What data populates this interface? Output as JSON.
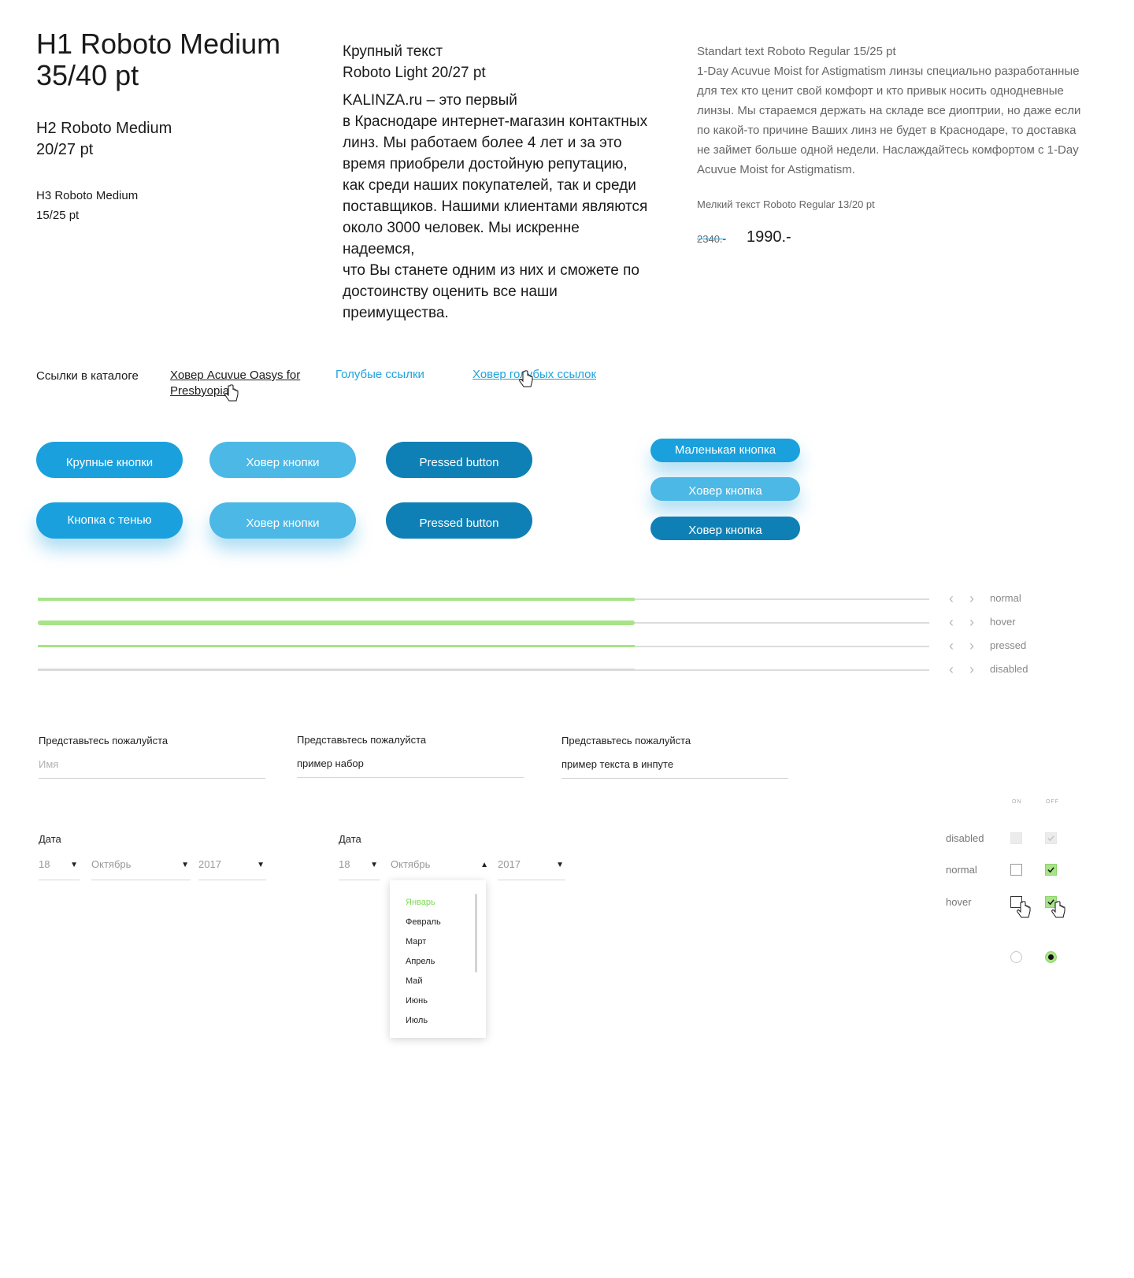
{
  "typography": {
    "h1": "H1 Roboto Medium\n35/40 pt",
    "h1_line1": "H1 Roboto Medium",
    "h1_line2": "35/40 pt",
    "h2_line1": "H2 Roboto Medium",
    "h2_line2": "20/27 pt",
    "h3_line1": "H3 Roboto Medium",
    "h3_line2": "15/25 pt",
    "large_title_line1": "Крупный текст",
    "large_title_line2": "Roboto Light 20/27 pt",
    "large_body": "KALINZA.ru – это первый\nв Краснодаре интернет-магазин контактных линз. Мы работаем более 4 лет и за это время приобрели достойную репутацию, как среди наших покупателей, так и среди поставщиков. Нашими клиентами являются около 3000 человек. Мы искренне надеемся,\nчто Вы станете одним из них и сможете по достоинству оценить все наши преимущества.",
    "standard_title": "Standart text Roboto Regular 15/25 pt",
    "standard_body": "1-Day Acuvue Moist for Astigmatism линзы специально разработанные для тех кто ценит свой комфорт и кто привык носить однодневные линзы. Мы стараемся держать на складе все диоптрии, но даже если по какой-то причине Ваших линз не будет в Краснодаре, то доставка не займет больше одной недели. Наслаждайтесь комфортом с 1-Day Acuvue Moist for Astigmatism.",
    "small_title": "Мелкий текст Roboto Regular 13/20 pt",
    "price_old": "2340.-",
    "price_new": "1990.-"
  },
  "links": {
    "catalog_label": "Ссылки в каталоге",
    "hover_link": "Ховер Acuvue Oasys for Presbyopia",
    "blue_link": "Голубые ссылки",
    "blue_hover_link": "Ховер голубых ссылок"
  },
  "buttons": {
    "large": "Крупные кнопки",
    "large_hover": "Ховер кнопки",
    "large_pressed": "Pressed button",
    "shadow": "Кнопка с тенью",
    "shadow_hover": "Ховер кнопки",
    "shadow_pressed": "Pressed button",
    "small": "Маленькая кнопка",
    "small_hover": "Ховер кнопка",
    "small_pressed": "Ховер кнопка"
  },
  "colors": {
    "accent_blue": "#1aa1dd",
    "hover_blue": "#4cb8e6",
    "pressed_blue": "#0f80b5",
    "accent_green": "#a8e388"
  },
  "sliders": {
    "fill_fraction": 0.67,
    "states": [
      "normal",
      "hover",
      "pressed",
      "disabled"
    ],
    "prev_icon": "chevron-left-icon",
    "next_icon": "chevron-right-icon"
  },
  "inputs": [
    {
      "label": "Представьтесь пожалуйста",
      "placeholder": "Имя",
      "value": ""
    },
    {
      "label": "Представьтесь пожалуйста",
      "placeholder": "",
      "value": "пример набор"
    },
    {
      "label": "Представьтесь пожалуйста",
      "placeholder": "",
      "value": "пример текста в инпуте"
    }
  ],
  "date": {
    "label": "Дата",
    "day": "18",
    "month": "Октябрь",
    "year": "2017",
    "months": [
      "Январь",
      "Февраль",
      "Март",
      "Апрель",
      "Май",
      "Июнь",
      "Июль"
    ],
    "selected_month": "Январь"
  },
  "checkboxes": {
    "col_on": "ON",
    "col_off": "OFF",
    "rows": [
      "disabled",
      "normal",
      "hover"
    ]
  }
}
